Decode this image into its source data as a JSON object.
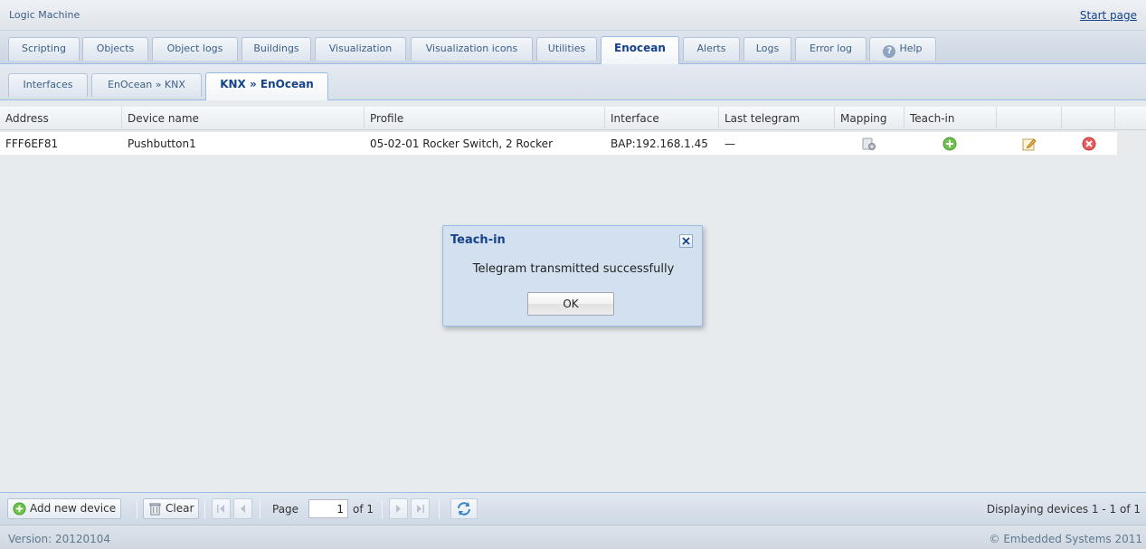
{
  "header": {
    "app_title": "Logic Machine",
    "start_page_link": "Start page"
  },
  "main_tabs": [
    {
      "label": "Scripting",
      "active": false
    },
    {
      "label": "Objects",
      "active": false
    },
    {
      "label": "Object logs",
      "active": false
    },
    {
      "label": "Buildings",
      "active": false
    },
    {
      "label": "Visualization",
      "active": false
    },
    {
      "label": "Visualization icons",
      "active": false
    },
    {
      "label": "Utilities",
      "active": false
    },
    {
      "label": "Enocean",
      "active": true
    },
    {
      "label": "Alerts",
      "active": false
    },
    {
      "label": "Logs",
      "active": false
    },
    {
      "label": "Error log",
      "active": false
    },
    {
      "label": "Help",
      "active": false,
      "icon": "help-icon"
    }
  ],
  "sub_tabs": [
    {
      "label": "Interfaces",
      "active": false
    },
    {
      "label": "EnOcean » KNX",
      "active": false
    },
    {
      "label": "KNX » EnOcean",
      "active": true
    }
  ],
  "grid": {
    "columns": [
      "Address",
      "Device name",
      "Profile",
      "Interface",
      "Last telegram",
      "Mapping",
      "Teach-in",
      "",
      ""
    ],
    "rows": [
      {
        "address": "FFF6EF81",
        "device_name": "Pushbutton1",
        "profile": "05-02-01 Rocker Switch, 2 Rocker",
        "interface": "BAP:192.168.1.45",
        "last_telegram": "—",
        "mapping_icon": "mapping-gear-icon",
        "teach_in_icon": "teach-in-plus-icon",
        "edit_icon": "edit-pencil-icon",
        "delete_icon": "delete-x-icon"
      }
    ]
  },
  "dialog": {
    "title": "Teach-in",
    "message": "Telegram transmitted successfully",
    "ok_label": "OK"
  },
  "toolbar": {
    "add_label": "Add new device",
    "clear_label": "Clear",
    "page_label": "Page",
    "page_value": "1",
    "of_label": "of 1",
    "display_info": "Displaying devices 1 - 1 of 1"
  },
  "footer": {
    "version": "Version: 20120104",
    "copyright": "© Embedded Systems 2011"
  },
  "colors": {
    "accent": "#15428b",
    "border": "#99bbe8",
    "add_green": "#5cb85c",
    "delete_red": "#e05050"
  }
}
